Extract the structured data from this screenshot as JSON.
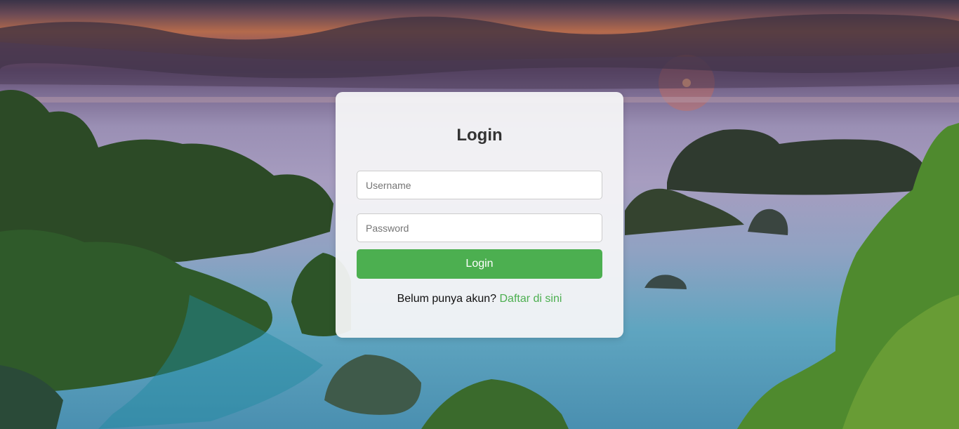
{
  "login": {
    "title": "Login",
    "username_placeholder": "Username",
    "password_placeholder": "Password",
    "submit_label": "Login",
    "register_prompt": "Belum punya akun?",
    "register_link": "Daftar di sini"
  },
  "colors": {
    "accent": "#4caf50",
    "card_background": "#f5f5f7"
  }
}
